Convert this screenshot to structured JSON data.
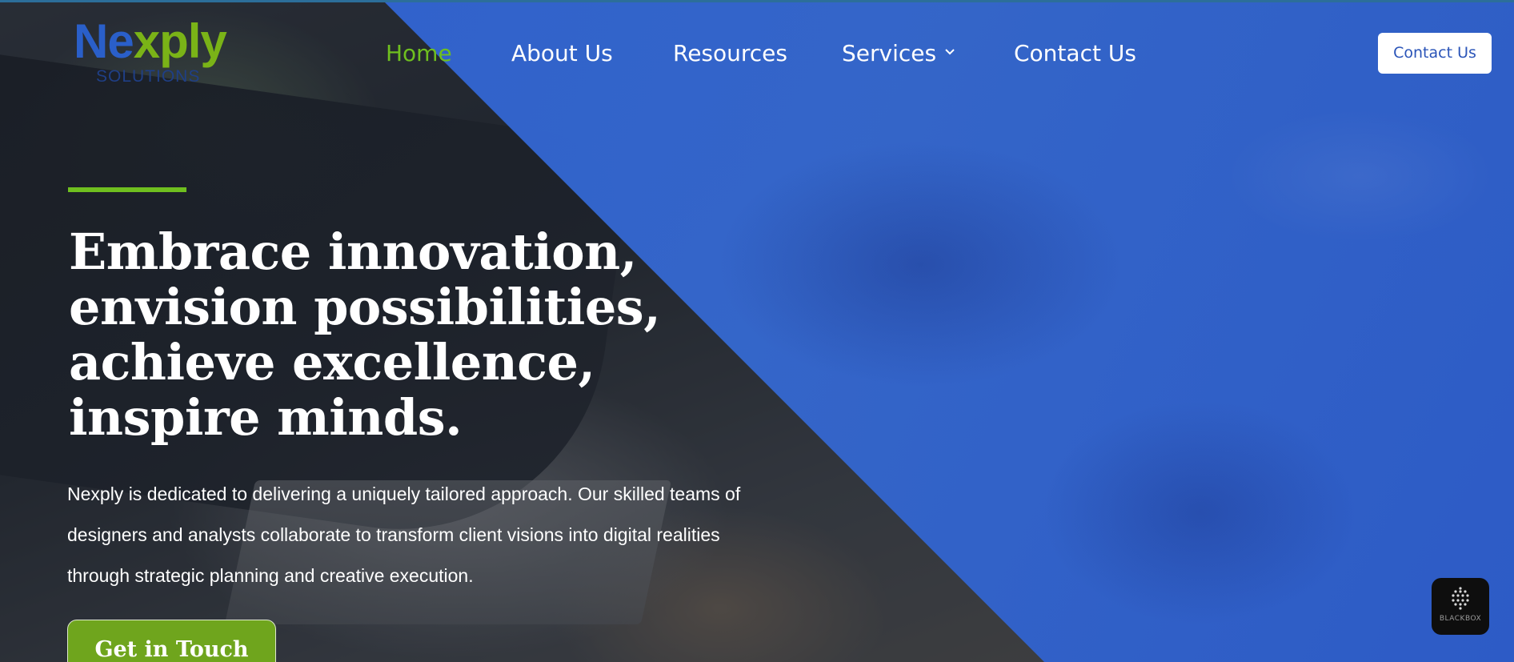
{
  "brand": {
    "logo_main": "Ne",
    "logo_x": "x",
    "logo_ply": "ply",
    "logo_sub": "SOLUTIONS",
    "colors": {
      "blue": "#2a5fc9",
      "green": "#7ab317",
      "navy": "#1f3f86"
    }
  },
  "nav": {
    "items": [
      {
        "label": "Home",
        "active": true
      },
      {
        "label": "About Us",
        "active": false
      },
      {
        "label": "Resources",
        "active": false
      },
      {
        "label": "Services",
        "active": false,
        "has_dropdown": true,
        "icon": "chevron-down-icon"
      },
      {
        "label": "Contact Us",
        "active": false
      }
    ],
    "cta_label": "Contact Us"
  },
  "hero": {
    "headline": [
      "Embrace innovation,",
      "envision possibilities,",
      "achieve excellence,",
      "inspire minds."
    ],
    "description_lines": [
      "Nexply is dedicated to delivering a uniquely tailored approach. Our skilled teams of",
      "designers and analysts collaborate to transform client visions into digital realities",
      "through strategic planning and creative execution."
    ],
    "cta_label": "Get in Touch",
    "colors": {
      "overlay": "#2f62d4",
      "accent": "#6fbf1f",
      "button": "#6fa51d"
    }
  },
  "widget": {
    "label": "BLACKBOX",
    "icon": "blackbox-logo-icon"
  }
}
